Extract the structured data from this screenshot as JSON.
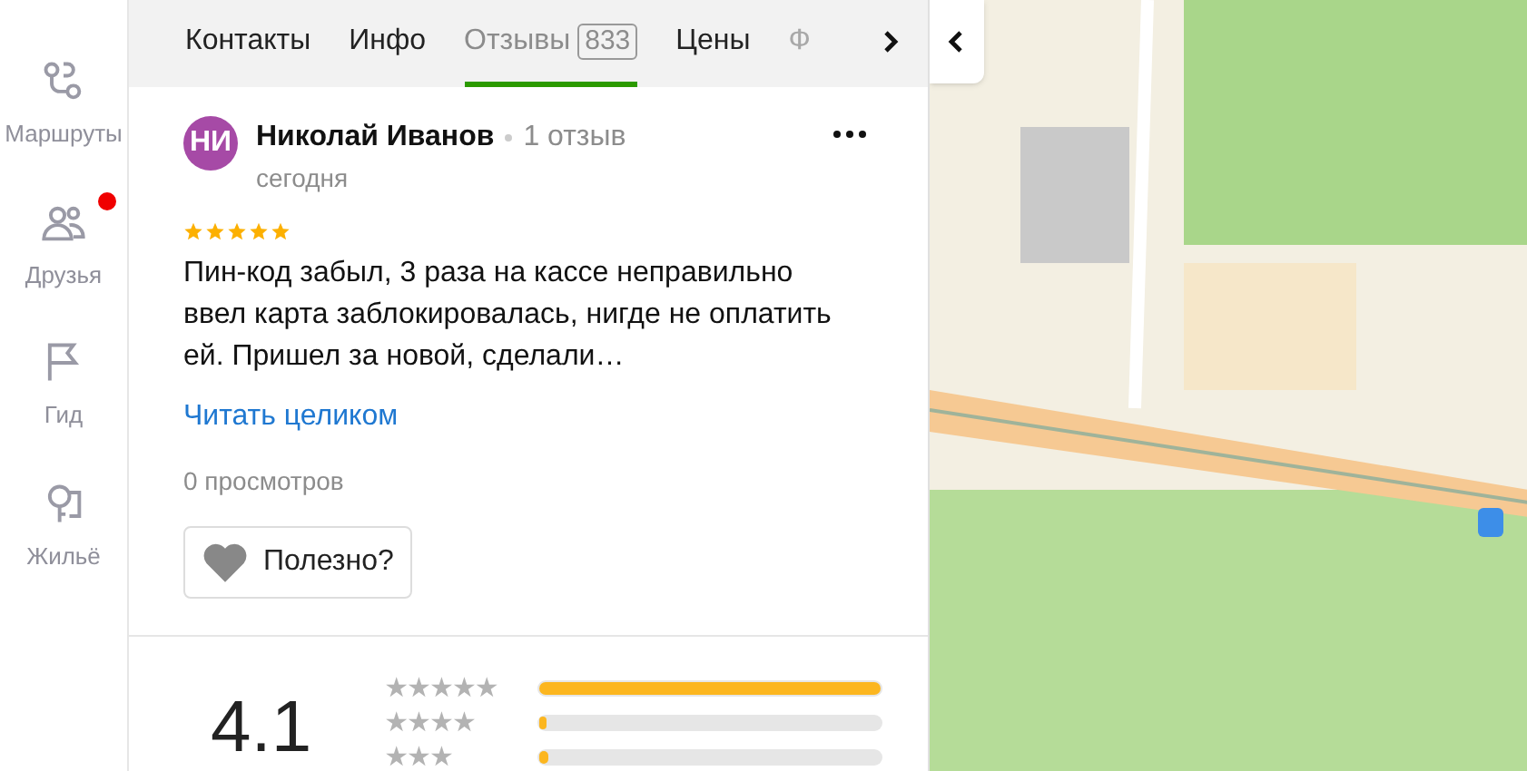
{
  "sidebar": {
    "items": [
      {
        "kind": "routes",
        "label": "Маршруты",
        "notification": false
      },
      {
        "kind": "friends",
        "label": "Друзья",
        "notification": true
      },
      {
        "kind": "guide",
        "label": "Гид",
        "notification": false
      },
      {
        "kind": "housing",
        "label": "Жильё",
        "notification": false
      }
    ]
  },
  "tabs": [
    {
      "label": "Контакты",
      "selected": false,
      "faded": false
    },
    {
      "label": "Инфо",
      "selected": false,
      "faded": false
    },
    {
      "label": "Отзывы",
      "badge": "833",
      "selected": true,
      "faded": false
    },
    {
      "label": "Цены",
      "selected": false,
      "faded": false
    },
    {
      "label": "Ф",
      "selected": false,
      "faded": true
    }
  ],
  "review": {
    "initials": "НИ",
    "author": "Николай Иванов",
    "author_reviews": "1 отзыв",
    "date": "сегодня",
    "stars": 5,
    "text": "Пин-код забыл, 3 раза на кассе неправильно ввел карта заблокировалась, нигде не оплатить ей. Пришел за новой, сделали…",
    "read_more": "Читать целиком",
    "views": "0 просмотров",
    "helpful": "Полезно?"
  },
  "rating": {
    "score": "4.1",
    "rows": [
      {
        "label": "★★★★★",
        "level": 1.0
      },
      {
        "label": "★★★★",
        "level": 0.02
      },
      {
        "label": "★★★",
        "level": 0.03
      }
    ]
  }
}
